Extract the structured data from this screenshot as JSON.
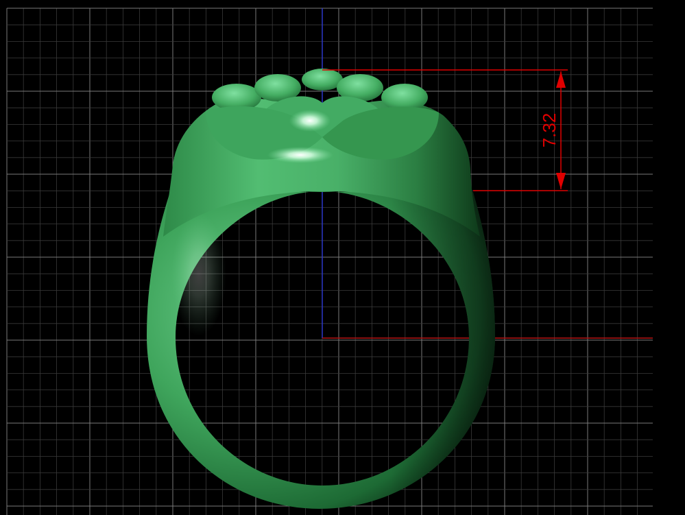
{
  "dimension": {
    "value": "7.32"
  },
  "colors": {
    "background": "#000000",
    "grid_minor": "#3a3a3a",
    "grid_major": "#7a7a7a",
    "axis_vertical": "#2a36c8",
    "axis_horizontal": "#b81414",
    "dimension": "#e00000",
    "model_base": "#3fa55c",
    "model_dark": "#0d3f1c",
    "model_light": "#7fe0a0"
  },
  "model": {
    "name-icon": "ring-3d-model"
  }
}
